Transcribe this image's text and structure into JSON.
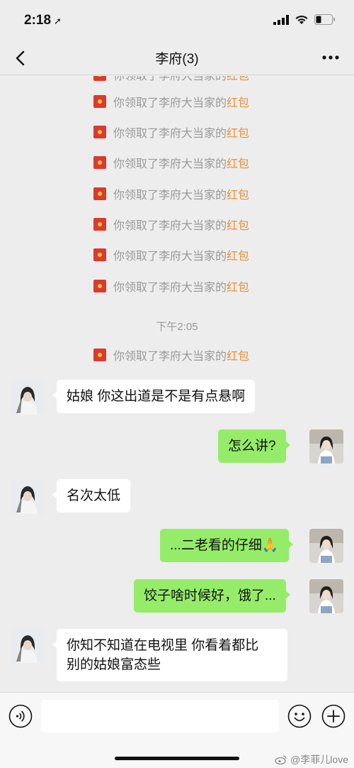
{
  "status_bar": {
    "time": "2:18",
    "location_glyph": "➚"
  },
  "nav": {
    "title": "李府(3)",
    "back_icon": "chevron-left-icon",
    "more_icon": "more-dots-icon"
  },
  "system_messages": {
    "prefix": "你领取了李府大当家的",
    "link": "红包",
    "timestamp": "下午2:05"
  },
  "messages": [
    {
      "side": "left",
      "text": "姑娘 你这出道是不是有点悬啊"
    },
    {
      "side": "right",
      "text": "怎么讲?"
    },
    {
      "side": "left",
      "text": "名次太低"
    },
    {
      "side": "right",
      "text": "...二老看的仔细🙏"
    },
    {
      "side": "right",
      "text": "饺子啥时候好，饿了..."
    },
    {
      "side": "left",
      "text": "你知不知道在电视里 你看着都比\n别的姑娘富态些"
    }
  ],
  "input": {
    "value": "",
    "placeholder": ""
  },
  "watermark": "@李菲儿love",
  "colors": {
    "accent_green": "#95ec69",
    "redpacket_link": "#e8903a",
    "background": "#ededed"
  }
}
